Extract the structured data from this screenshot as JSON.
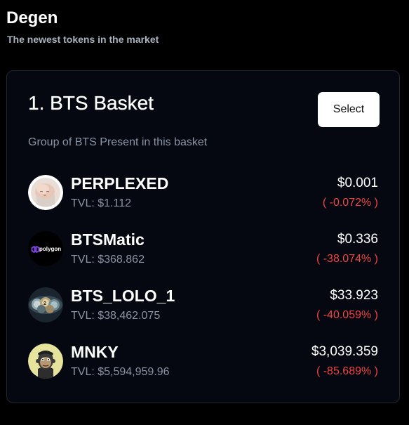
{
  "header": {
    "title": "Degen",
    "subtitle": "The newest tokens in the market"
  },
  "basket": {
    "title": "1. BTS Basket",
    "select_label": "Select",
    "description": "Group of BTS Present in this basket"
  },
  "tokens": [
    {
      "name": "PERPLEXED",
      "tvl": "TVL: $1.112",
      "price": "$0.001",
      "change": "( -0.072% )",
      "icon": "baby-photo-avatar"
    },
    {
      "name": "BTSMatic",
      "tvl": "TVL: $368.862",
      "price": "$0.336",
      "change": "( -38.074% )",
      "icon": "polygon-logo",
      "logo_text": "polygon"
    },
    {
      "name": "BTS_LOLO_1",
      "tvl": "TVL: $38,462.075",
      "price": "$33.923",
      "change": "( -40.059% )",
      "icon": "coins-avatar"
    },
    {
      "name": "MNKY",
      "tvl": "TVL: $5,594,959.96",
      "price": "$3,039.359",
      "change": "( -85.689% )",
      "icon": "ape-avatar"
    }
  ],
  "colors": {
    "background": "#000000",
    "card": "#050810",
    "muted_text": "#8a94a6",
    "negative": "#ef4444",
    "button_bg": "#ffffff"
  }
}
